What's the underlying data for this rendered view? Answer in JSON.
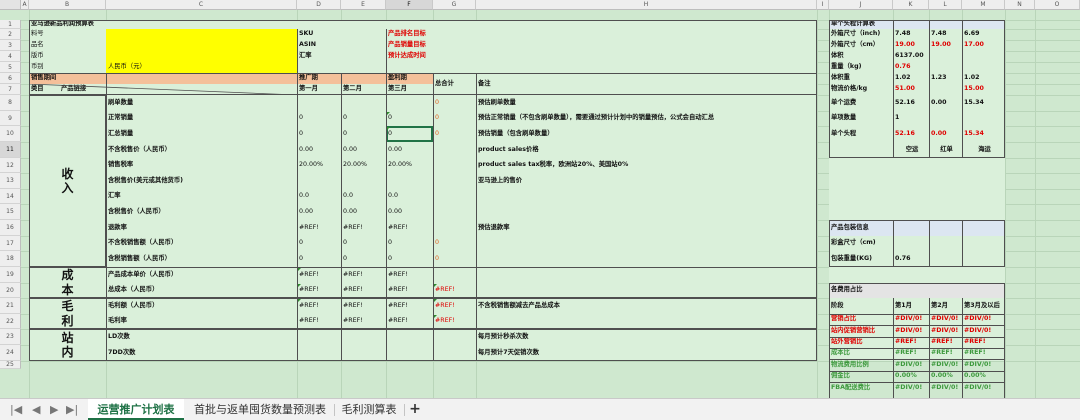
{
  "columns": [
    "A",
    "B",
    "C",
    "D",
    "E",
    "F",
    "G",
    "H",
    "I",
    "J",
    "K",
    "L",
    "M",
    "N",
    "O"
  ],
  "rows": [
    "1",
    "2",
    "3",
    "4",
    "5",
    "6",
    "7",
    "8",
    "9",
    "10",
    "11",
    "12",
    "13",
    "14",
    "15",
    "16",
    "17",
    "18",
    "19",
    "20",
    "21",
    "22",
    "23",
    "24",
    "25"
  ],
  "sheet": {
    "title": "亚马逊新品利润预算表",
    "info": {
      "l1": "料号",
      "l2": "品名",
      "l3": "版币",
      "l4": "币别",
      "rmb": "人民币（元）",
      "sku": "SKU",
      "asin": "ASIN",
      "fx": "汇率",
      "t1": "产品排名目标",
      "t2": "产品销量目标",
      "t3": "预计达成时间"
    },
    "header": {
      "period": "销售期间",
      "promo": "推广期",
      "profit": "盈利期",
      "total": "总合计",
      "note": "备注",
      "cat": "类目",
      "link": "产品链接",
      "m1": "第一月",
      "m2": "第二月",
      "m3": "第三月"
    },
    "sections": {
      "income": "收\n入",
      "cost": "成\n本",
      "gross": "毛\n利",
      "site": "站\n内"
    },
    "lines": [
      {
        "label": "刷单数量",
        "m1": "",
        "m2": "",
        "m3": "",
        "tot": "0",
        "note": "预估刷单数量"
      },
      {
        "label": "正常销量",
        "m1": "0",
        "m2": "0",
        "m3": "0",
        "tot": "0",
        "note": "预估正常销量（不包含刷单数量），需要通过预计计划中的销量预估，公式会自动汇总"
      },
      {
        "label": "汇总销量",
        "m1": "0",
        "m2": "0",
        "m3": "0",
        "tot": "0",
        "note": "预估销量（包含刷单数量）"
      },
      {
        "label": "不含税售价（人民币）",
        "m1": "0.00",
        "m2": "0.00",
        "m3": "0.00",
        "tot": "",
        "note": "product sales价格"
      },
      {
        "label": "销售税率",
        "m1": "20.00%",
        "m2": "20.00%",
        "m3": "20.00%",
        "tot": "",
        "note": "product sales tax税率，欧洲站20%、美国站0%"
      },
      {
        "label": "含税售价(美元或其他货币)",
        "m1": "",
        "m2": "",
        "m3": "",
        "tot": "",
        "note": "亚马逊上的售价"
      },
      {
        "label": "汇率",
        "m1": "0.0",
        "m2": "0.0",
        "m3": "0.0",
        "tot": "",
        "note": ""
      },
      {
        "label": "含税售价（人民币）",
        "m1": "0.00",
        "m2": "0.00",
        "m3": "0.00",
        "tot": "",
        "note": ""
      },
      {
        "label": "退款率",
        "m1": "#REF!",
        "m2": "#REF!",
        "m3": "#REF!",
        "tot": "",
        "note": "预估退款率"
      },
      {
        "label": "不含税销售额（人民币）",
        "m1": "0",
        "m2": "0",
        "m3": "0",
        "tot": "0",
        "note": ""
      },
      {
        "label": "含税销售额（人民币）",
        "m1": "0",
        "m2": "0",
        "m3": "0",
        "tot": "0",
        "note": ""
      },
      {
        "label": "产品成本单价（人民币）",
        "m1": "#REF!",
        "m2": "#REF!",
        "m3": "#REF!",
        "tot": "",
        "note": ""
      },
      {
        "label": "总成本（人民币）",
        "m1": "#REF!",
        "m2": "#REF!",
        "m3": "#REF!",
        "tot": "#REF!",
        "note": ""
      },
      {
        "label": "毛利额（人民币）",
        "m1": "#REF!",
        "m2": "#REF!",
        "m3": "#REF!",
        "tot": "#REF!",
        "note": "不含税销售额减去产品总成本"
      },
      {
        "label": "毛利率",
        "m1": "#REF!",
        "m2": "#REF!",
        "m3": "#REF!",
        "tot": "#REF!",
        "note": ""
      },
      {
        "label": "LD次数",
        "m1": "",
        "m2": "",
        "m3": "",
        "tot": "",
        "note": "每月预计秒杀次数"
      },
      {
        "label": "7DD次数",
        "m1": "",
        "m2": "",
        "m3": "",
        "tot": "",
        "note": "每月预计7天促销次数"
      }
    ],
    "right": {
      "title": "单个头程计算表",
      "outer_in": "外箱尺寸（inch)",
      "oi": [
        "7.48",
        "7.48",
        "6.69"
      ],
      "outer_cm": "外箱尺寸（cm）",
      "oc": [
        "19.00",
        "19.00",
        "17.00"
      ],
      "volume": "体积",
      "vol": "6137.00",
      "weight": "重量（kg)",
      "wt": "0.76",
      "vweight": "体积重",
      "vw": [
        "1.02",
        "1.23",
        "1.02"
      ],
      "price": "物流价格/kg",
      "pr": [
        "51.00",
        "",
        "15.00"
      ],
      "unitfreight": "单个运费",
      "uf": [
        "52.16",
        "0.00",
        "15.34"
      ],
      "boxqty": "单项数量",
      "bq": "1",
      "unithead": "单个头程",
      "uh": [
        "52.16",
        "0.00",
        "15.34"
      ],
      "modes": [
        "空运",
        "红单",
        "海运"
      ],
      "pack_title": "产品包装信息",
      "pack_size": "彩盒尺寸（cm)",
      "pack_weight": "包装重量(KG)",
      "pw": "0.76",
      "fee_title": "各费用占比",
      "fee_stage": "阶段",
      "f1": "第1月",
      "f2": "第2月",
      "f3": "第3月及以后",
      "fees": [
        {
          "label": "营销占比",
          "cls": "red",
          "v": [
            "#DIV/0!",
            "#DIV/0!",
            "#DIV/0!"
          ]
        },
        {
          "label": "站内促销营销比",
          "cls": "red",
          "v": [
            "#DIV/0!",
            "#DIV/0!",
            "#DIV/0!"
          ]
        },
        {
          "label": "站外营销比",
          "cls": "red",
          "v": [
            "#REF!",
            "#REF!",
            "#REF!"
          ]
        },
        {
          "label": "成本比",
          "cls": "gr",
          "v": [
            "#REF!",
            "#REF!",
            "#REF!"
          ]
        },
        {
          "label": "物流费用比例",
          "cls": "gr",
          "v": [
            "#DIV/0!",
            "#DIV/0!",
            "#DIV/0!"
          ]
        },
        {
          "label": "佣金比",
          "cls": "gr",
          "v": [
            "0.00%",
            "0.00%",
            "0.00%"
          ]
        },
        {
          "label": "FBA配送费比",
          "cls": "gr",
          "v": [
            "#DIV/0!",
            "#DIV/0!",
            "#DIV/0!"
          ]
        }
      ]
    }
  },
  "tabs": [
    "运营推广计划表",
    "首批与返单囤货数量预测表",
    "毛利测算表"
  ],
  "add_tab": "+",
  "nav": [
    "|◀",
    "◀",
    "▶",
    "▶|"
  ]
}
